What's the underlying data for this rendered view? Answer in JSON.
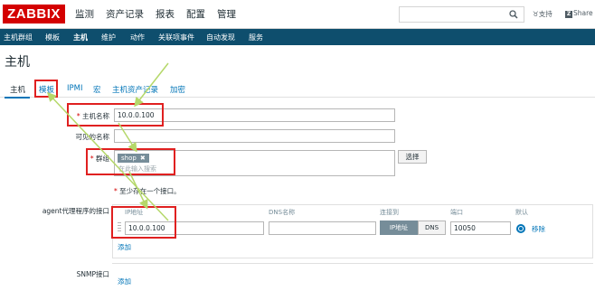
{
  "header": {
    "logo": "ZABBIX",
    "menu": [
      "监测",
      "资产记录",
      "报表",
      "配置",
      "管理"
    ],
    "search_placeholder": "",
    "support": "支持",
    "share": "Share"
  },
  "subnav": [
    "主机群组",
    "模板",
    "主机",
    "维护",
    "动作",
    "关联项事件",
    "自动发现",
    "服务"
  ],
  "page_title": "主机",
  "tabs": [
    "主机",
    "模板",
    "IPMI",
    "宏",
    "主机资产记录",
    "加密"
  ],
  "form": {
    "hostname_label": "主机名称",
    "hostname_value": "10.0.0.100",
    "visible_name_label": "可见的名称",
    "visible_name_value": "",
    "groups_label": "群组",
    "group_tag": "shop",
    "group_tag_remove": "✖",
    "groups_placeholder": "在此输入搜索",
    "select_button": "选择",
    "min_interface_note": "至少存在一个接口。",
    "required_mark": "*",
    "agent_label": "agent代理程序的接口",
    "snmp_label": "SNMP接口",
    "add_link": "添加"
  },
  "interfaces": {
    "headers": {
      "ip": "IP地址",
      "dns": "DNS名称",
      "connect_to": "连接到",
      "port": "端口",
      "default": "默认"
    },
    "row": {
      "ip": "10.0.0.100",
      "dns": "",
      "connect_ip": "IP地址",
      "connect_dns": "DNS",
      "port": "10050",
      "remove": "移除"
    }
  },
  "colors": {
    "brand_red": "#d40000",
    "nav_blue": "#0e4e6d",
    "link_blue": "#0275b8",
    "annotation_red": "#e02020",
    "annotation_arrow": "#b5d86a"
  }
}
